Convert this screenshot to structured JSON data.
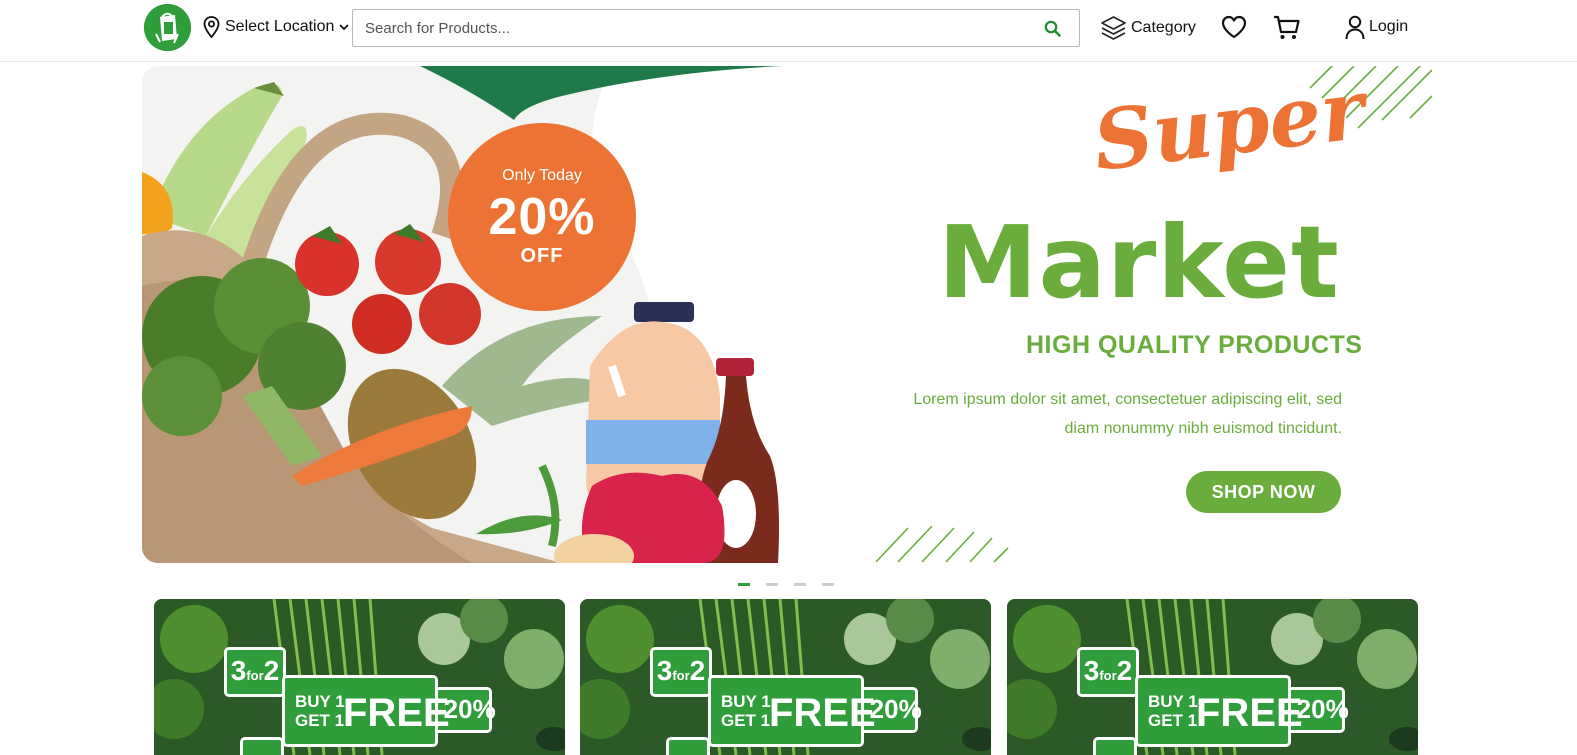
{
  "header": {
    "location_label": "Select Location",
    "search_placeholder": "Search for Products...",
    "category_label": "Category",
    "login_label": "Login",
    "icons": [
      "logo-icon",
      "location-pin-icon",
      "chevron-down-icon",
      "search-icon",
      "layers-icon",
      "heart-icon",
      "cart-icon",
      "user-icon"
    ]
  },
  "hero": {
    "offer_top": "Only Today",
    "offer_value": "20%",
    "offer_bottom": "OFF",
    "title_script": "Super",
    "title_main": "Market",
    "subtitle": "HIGH QUALITY PRODUCTS",
    "description": "Lorem ipsum dolor sit amet, consectetuer adipiscing elit, sed diam nonummy nibh euismod tincidunt.",
    "cta_label": "SHOP NOW",
    "colors": {
      "orange": "#ec7334",
      "green": "#6aad3c",
      "dark_green": "#1f7a4a"
    }
  },
  "carousel": {
    "slides": 4,
    "active_index": 0
  },
  "promos": [
    {
      "badge_3for2": "3",
      "badge_for": "for",
      "badge_2": "2",
      "buy_line": "BUY 1",
      "get_line": "GET 1",
      "free": "FREE",
      "pct": "-20%"
    },
    {
      "badge_3for2": "3",
      "badge_for": "for",
      "badge_2": "2",
      "buy_line": "BUY 1",
      "get_line": "GET 1",
      "free": "FREE",
      "pct": "-20%"
    },
    {
      "badge_3for2": "3",
      "badge_for": "for",
      "badge_2": "2",
      "buy_line": "BUY 1",
      "get_line": "GET 1",
      "free": "FREE",
      "pct": "-20%"
    }
  ]
}
